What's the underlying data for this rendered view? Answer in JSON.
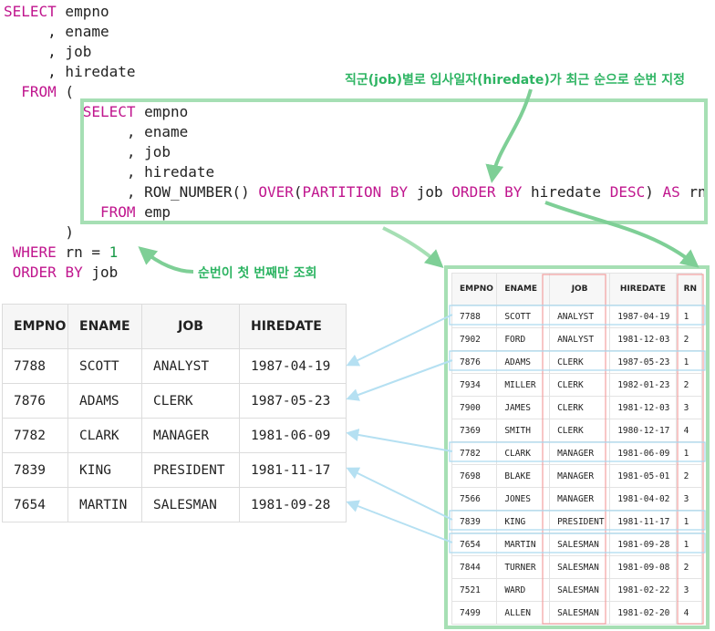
{
  "code_lines": [
    {
      "tokens": [
        {
          "t": "SELECT",
          "k": "kw"
        },
        {
          "t": " empno"
        }
      ]
    },
    {
      "tokens": [
        {
          "t": "     , ename"
        }
      ]
    },
    {
      "tokens": [
        {
          "t": "     , job"
        }
      ]
    },
    {
      "tokens": [
        {
          "t": "     , hiredate"
        }
      ]
    },
    {
      "tokens": [
        {
          "t": "  "
        },
        {
          "t": "FROM",
          "k": "kw"
        },
        {
          "t": " ("
        }
      ]
    },
    {
      "tokens": [
        {
          "t": "         "
        },
        {
          "t": "SELECT",
          "k": "kw"
        },
        {
          "t": " empno"
        }
      ]
    },
    {
      "tokens": [
        {
          "t": "              , ename"
        }
      ]
    },
    {
      "tokens": [
        {
          "t": "              , job"
        }
      ]
    },
    {
      "tokens": [
        {
          "t": "              , hiredate"
        }
      ]
    },
    {
      "tokens": [
        {
          "t": "              , ROW_NUMBER() "
        },
        {
          "t": "OVER",
          "k": "kw"
        },
        {
          "t": "("
        },
        {
          "t": "PARTITION BY",
          "k": "kw"
        },
        {
          "t": " job "
        },
        {
          "t": "ORDER BY",
          "k": "kw"
        },
        {
          "t": " hiredate "
        },
        {
          "t": "DESC",
          "k": "kw"
        },
        {
          "t": ") "
        },
        {
          "t": "AS",
          "k": "kw"
        },
        {
          "t": " rn"
        }
      ]
    },
    {
      "tokens": [
        {
          "t": "           "
        },
        {
          "t": "FROM",
          "k": "kw"
        },
        {
          "t": " emp"
        }
      ]
    },
    {
      "tokens": [
        {
          "t": "       )"
        }
      ]
    },
    {
      "tokens": [
        {
          "t": " "
        },
        {
          "t": "WHERE",
          "k": "kw"
        },
        {
          "t": " rn = "
        },
        {
          "t": "1",
          "k": "num"
        }
      ]
    },
    {
      "tokens": [
        {
          "t": " "
        },
        {
          "t": "ORDER",
          "k": "kw"
        },
        {
          "t": " "
        },
        {
          "t": "BY",
          "k": "kw"
        },
        {
          "t": " job"
        }
      ]
    }
  ],
  "annotations": {
    "partition_note": "직군(job)별로 입사일자(hiredate)가 최근 순으로 순번 지정",
    "filter_note": "순번이 첫 번째만 조회"
  },
  "result_table": {
    "headers": [
      "EMPNO",
      "ENAME",
      "JOB",
      "HIREDATE"
    ],
    "rows": [
      [
        "7788",
        "SCOTT",
        "ANALYST",
        "1987-04-19"
      ],
      [
        "7876",
        "ADAMS",
        "CLERK",
        "1987-05-23"
      ],
      [
        "7782",
        "CLARK",
        "MANAGER",
        "1981-06-09"
      ],
      [
        "7839",
        "KING",
        "PRESIDENT",
        "1981-11-17"
      ],
      [
        "7654",
        "MARTIN",
        "SALESMAN",
        "1981-09-28"
      ]
    ]
  },
  "full_table": {
    "headers": [
      "EMPNO",
      "ENAME",
      "JOB",
      "HIREDATE",
      "RN"
    ],
    "rows": [
      [
        "7788",
        "SCOTT",
        "ANALYST",
        "1987-04-19",
        "1"
      ],
      [
        "7902",
        "FORD",
        "ANALYST",
        "1981-12-03",
        "2"
      ],
      [
        "7876",
        "ADAMS",
        "CLERK",
        "1987-05-23",
        "1"
      ],
      [
        "7934",
        "MILLER",
        "CLERK",
        "1982-01-23",
        "2"
      ],
      [
        "7900",
        "JAMES",
        "CLERK",
        "1981-12-03",
        "3"
      ],
      [
        "7369",
        "SMITH",
        "CLERK",
        "1980-12-17",
        "4"
      ],
      [
        "7782",
        "CLARK",
        "MANAGER",
        "1981-06-09",
        "1"
      ],
      [
        "7698",
        "BLAKE",
        "MANAGER",
        "1981-05-01",
        "2"
      ],
      [
        "7566",
        "JONES",
        "MANAGER",
        "1981-04-02",
        "3"
      ],
      [
        "7839",
        "KING",
        "PRESIDENT",
        "1981-11-17",
        "1"
      ],
      [
        "7654",
        "MARTIN",
        "SALESMAN",
        "1981-09-28",
        "1"
      ],
      [
        "7844",
        "TURNER",
        "SALESMAN",
        "1981-09-08",
        "2"
      ],
      [
        "7521",
        "WARD",
        "SALESMAN",
        "1981-02-22",
        "3"
      ],
      [
        "7499",
        "ALLEN",
        "SALESMAN",
        "1981-02-20",
        "4"
      ]
    ]
  },
  "colors": {
    "keyword": "#c0168e",
    "number": "#1a9a48",
    "annotation": "#2db462",
    "highlight_box": "#a6dfb4",
    "column_highlight": "#f2a0a0",
    "row_highlight": "#a8d8ee",
    "connector": "#b5e0f2"
  }
}
